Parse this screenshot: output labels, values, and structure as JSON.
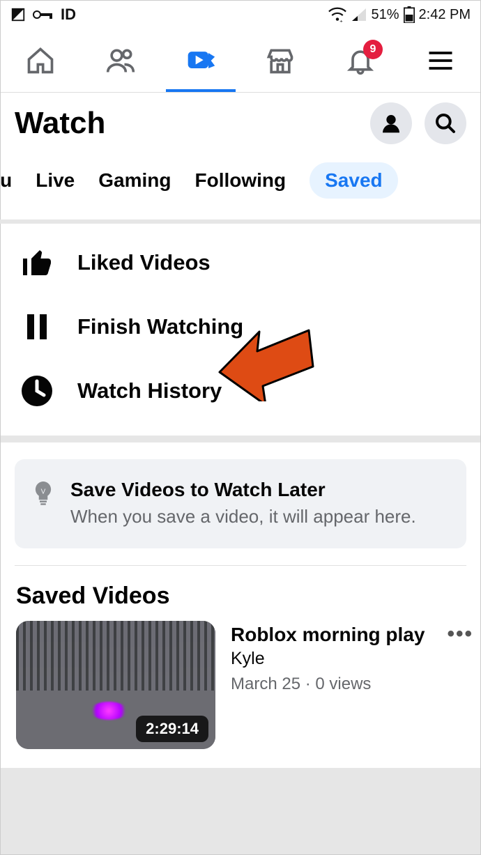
{
  "status": {
    "battery_pct": "51%",
    "time": "2:42 PM"
  },
  "nav": {
    "badge_count": "9"
  },
  "header": {
    "title": "Watch"
  },
  "tabs": {
    "items": [
      {
        "label": "You",
        "truncated": "ou"
      },
      {
        "label": "Live"
      },
      {
        "label": "Gaming"
      },
      {
        "label": "Following"
      },
      {
        "label": "Saved",
        "active": true
      }
    ]
  },
  "saved_menu": {
    "liked": "Liked Videos",
    "finish": "Finish Watching",
    "history": "Watch History"
  },
  "info": {
    "title": "Save Videos to Watch Later",
    "subtitle": "When you save a video, it will appear here."
  },
  "saved_videos": {
    "heading": "Saved Videos",
    "items": [
      {
        "title": "Roblox morning play",
        "author": "Kyle",
        "date": "March 25",
        "views": "0 views",
        "duration": "2:29:14"
      }
    ]
  }
}
